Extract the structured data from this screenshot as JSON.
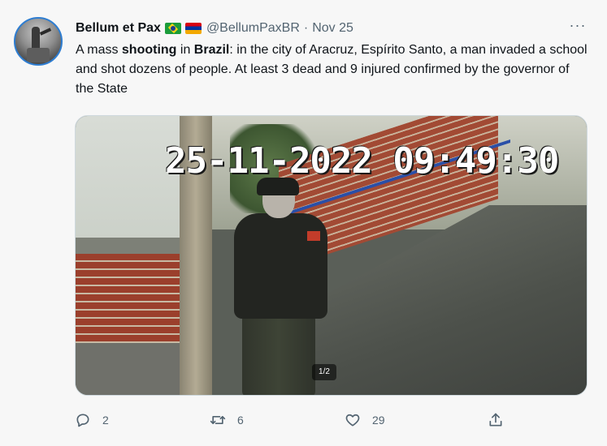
{
  "tweet": {
    "author_name": "Bellum et Pax",
    "flags": [
      "brazil-flag",
      "armenia-flag"
    ],
    "handle": "@BellumPaxBR",
    "separator": "·",
    "date": "Nov 25",
    "more_label": "···",
    "text": {
      "part1": "A mass ",
      "bold1": "shooting",
      "part2": " in ",
      "bold2": "Brazil",
      "part3": ": in the city of Aracruz, Espírito Santo, a man invaded a school and shot dozens of people. At least 3 dead and 9 injured confirmed by the governor of the State"
    },
    "media": {
      "timestamp": "25-11-2022 09:49:30",
      "counter": "1/2"
    },
    "actions": {
      "reply": {
        "icon": "reply-icon",
        "count": "2"
      },
      "retweet": {
        "icon": "retweet-icon",
        "count": "6"
      },
      "like": {
        "icon": "heart-icon",
        "count": "29"
      },
      "share": {
        "icon": "share-icon"
      }
    }
  },
  "colors": {
    "background": "#f7f7f7",
    "text": "#0f1419",
    "secondary": "#536471"
  }
}
